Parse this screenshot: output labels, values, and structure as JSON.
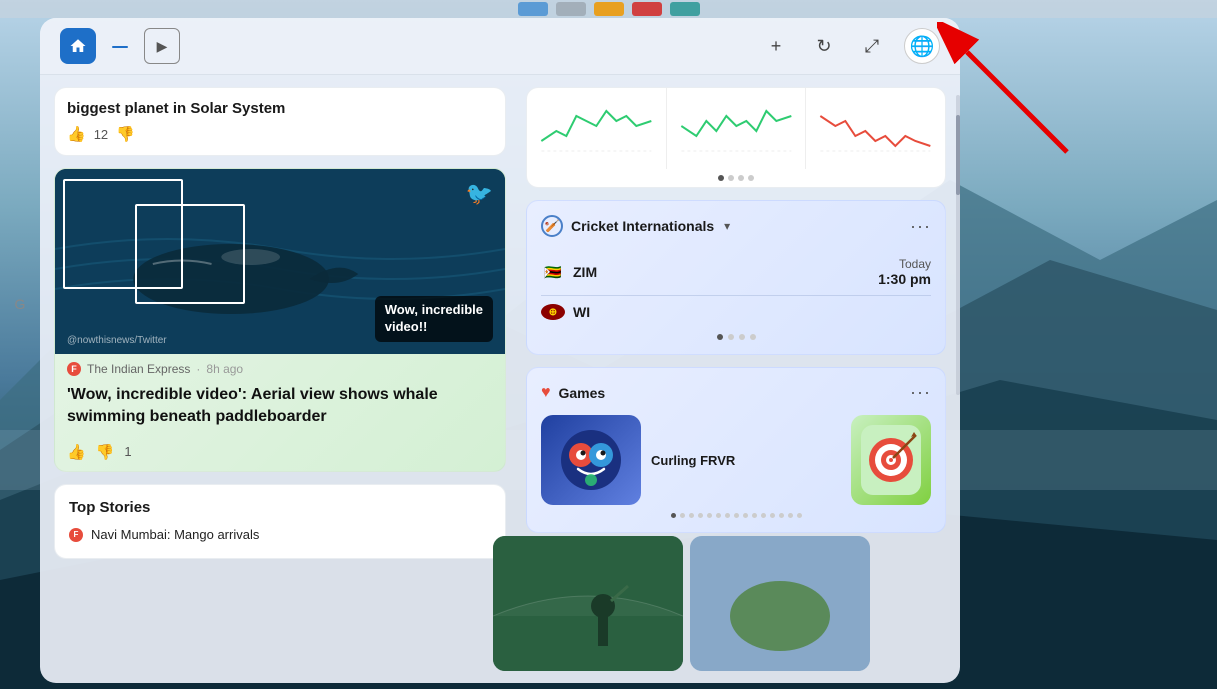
{
  "background": {
    "gradient_desc": "mountain landscape blue"
  },
  "taskbar": {
    "icons": [
      "home",
      "media",
      "orange-app",
      "red-app",
      "teal-app"
    ]
  },
  "panel": {
    "header": {
      "home_label": "🏠",
      "play_label": "▶",
      "add_label": "+",
      "refresh_label": "↻",
      "expand_label": "⤢",
      "avatar_label": "🌐"
    }
  },
  "left_column": {
    "top_article": {
      "title": "biggest planet in Solar System",
      "likes": "12",
      "like_icon": "👍",
      "dislike_icon": "👎"
    },
    "whale_article": {
      "image_alt": "Whale aerial view",
      "overlay_text": "Wow, incredible\nvideo!!",
      "source": "The Indian Express",
      "source_time": "8h ago",
      "headline": "'Wow, incredible video': Aerial view shows whale swimming beneath paddleboarder",
      "likes": "",
      "dislikes": "1"
    },
    "top_stories": {
      "title": "Top Stories",
      "story1": "Navi Mumbai: Mango arrivals"
    }
  },
  "right_column": {
    "charts_card": {
      "dots": [
        "active",
        "inactive",
        "inactive",
        "inactive"
      ],
      "charts": [
        {
          "type": "line",
          "color": "#2ecc71",
          "label": "chart1"
        },
        {
          "type": "line",
          "color": "#2ecc71",
          "label": "chart2"
        },
        {
          "type": "line",
          "color": "#e74c3c",
          "label": "chart3"
        }
      ]
    },
    "cricket_card": {
      "icon": "🏏",
      "title": "Cricket Internationals",
      "chevron": "▾",
      "more": "···",
      "matches": [
        {
          "team": "ZIM",
          "flag": "🇿🇼",
          "date": "Today",
          "time": "1:30 pm"
        },
        {
          "team": "WI",
          "flag": "🏴",
          "date": "",
          "time": ""
        }
      ],
      "dots": [
        "active",
        "inactive",
        "inactive",
        "inactive"
      ]
    },
    "games_card": {
      "heart": "♥",
      "title": "Games",
      "more": "···",
      "game1": {
        "name": "Curling FRVR",
        "thumb_emoji": "🎯"
      },
      "game2": {
        "thumb_emoji": "🎯"
      },
      "dots": 15
    },
    "image_card": {
      "alt": "Cricket/Sports photo"
    }
  },
  "red_arrow": {
    "points_to": "avatar"
  }
}
